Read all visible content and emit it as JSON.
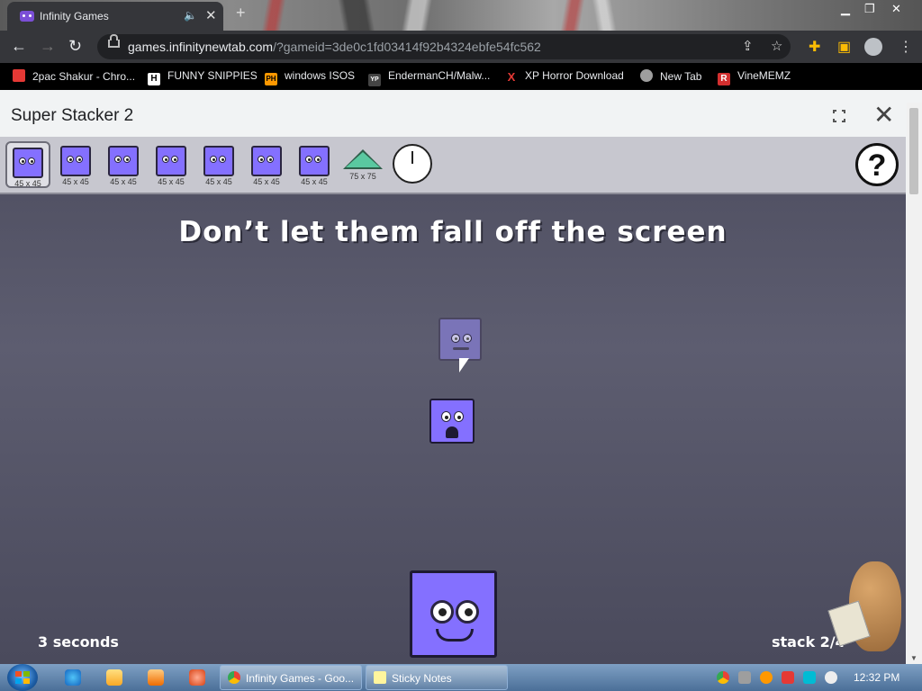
{
  "browser": {
    "tab_title": "Infinity Games",
    "url_host": "games.infinitynewtab.com",
    "url_path": "/?gameid=3de0c1fd03414f92b4324ebfe54fc562"
  },
  "bookmarks": [
    {
      "label": "2pac Shakur - Chro...",
      "icon": "folder-icon",
      "color": "#e53935"
    },
    {
      "label": "FUNNY SNIPPIES",
      "icon": "h-icon",
      "glyph": "H",
      "color": "#ffffff"
    },
    {
      "label": "windows ISOS",
      "icon": "ph-icon",
      "glyph": "PH",
      "color": "#ff9800"
    },
    {
      "label": "EndermanCH/Malw...",
      "icon": "yp-icon",
      "glyph": "YP",
      "color": "#555555"
    },
    {
      "label": "XP Horror Download",
      "icon": "x-icon",
      "glyph": "X",
      "color": "#e53935"
    },
    {
      "label": "New Tab",
      "icon": "globe-icon",
      "color": "#9e9e9e"
    },
    {
      "label": "VineMEMZ",
      "icon": "r-icon",
      "glyph": "R",
      "color": "#d32f2f"
    }
  ],
  "game": {
    "title": "Super Stacker 2",
    "message": "Don’t let them fall off the screen",
    "timer": "3 seconds",
    "stack": "stack 2/4",
    "help_glyph": "?",
    "toolbar_items": [
      {
        "label": "45 x 45",
        "shape": "square",
        "selected": true
      },
      {
        "label": "45 x 45",
        "shape": "square",
        "selected": false
      },
      {
        "label": "45 x 45",
        "shape": "square",
        "selected": false
      },
      {
        "label": "45 x 45",
        "shape": "square",
        "selected": false
      },
      {
        "label": "45 x 45",
        "shape": "square",
        "selected": false
      },
      {
        "label": "45 x 45",
        "shape": "square",
        "selected": false
      },
      {
        "label": "45 x 45",
        "shape": "square",
        "selected": false
      },
      {
        "label": "75 x 75",
        "shape": "triangle",
        "selected": false
      }
    ],
    "colors": {
      "block": "#8470ff",
      "stage": "#55556a"
    }
  },
  "taskbar": {
    "buttons": [
      {
        "label": "Infinity Games - Goo...",
        "icon": "chrome-icon"
      },
      {
        "label": "Sticky Notes",
        "icon": "sticky-notes-icon"
      }
    ],
    "time": "12:32 PM"
  }
}
